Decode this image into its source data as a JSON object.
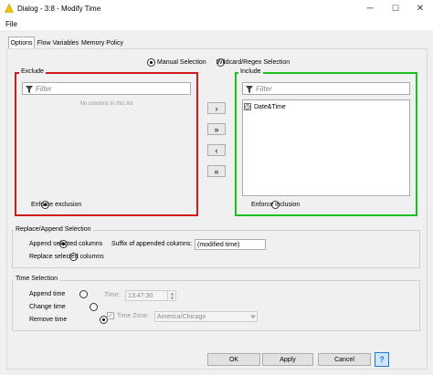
{
  "window": {
    "title": "Dialog - 3:8 - Modify Time",
    "minimize_glyph": "─",
    "maximize_glyph": "☐",
    "close_glyph": "✕"
  },
  "menu": {
    "file": "File"
  },
  "tabs": [
    "Options",
    "Flow Variables",
    "Memory Policy"
  ],
  "selection_mode": {
    "manual_label": "Manual Selection",
    "wildcard_label": "Wildcard/Regex Selection",
    "selected": "manual"
  },
  "exclude": {
    "title": "Exclude",
    "filter_placeholder": "Filter",
    "empty_text": "No columns in this list",
    "enforce_label": "Enforce exclusion",
    "enforce_selected": true,
    "border_color": "#d11919"
  },
  "include": {
    "title": "Include",
    "filter_placeholder": "Filter",
    "items": [
      {
        "label": "Date&Time",
        "icon": "clock-icon"
      }
    ],
    "enforce_label": "Enforce inclusion",
    "enforce_selected": false,
    "border_color": "#19c21f"
  },
  "shuttle": {
    "move_right": "›",
    "move_all_right": "»",
    "move_left": "‹",
    "move_all_left": "«"
  },
  "replace_append": {
    "title": "Replace/Append Selection",
    "append_label": "Append selected columns",
    "replace_label": "Replace selected columns",
    "selected": "append",
    "suffix_label": "Suffix of appended columns:",
    "suffix_value": "(modified time)"
  },
  "time_selection": {
    "title": "Time Selection",
    "append_label": "Append time",
    "change_label": "Change time",
    "remove_label": "Remove time",
    "selected": "remove",
    "time_label": "Time:",
    "time_value": "13:47:30",
    "timezone_label": "Time Zone:",
    "timezone_value": "America/Chicago",
    "timezone_checked": true
  },
  "buttons": {
    "ok": "OK",
    "apply": "Apply",
    "cancel": "Cancel",
    "help": "?"
  }
}
